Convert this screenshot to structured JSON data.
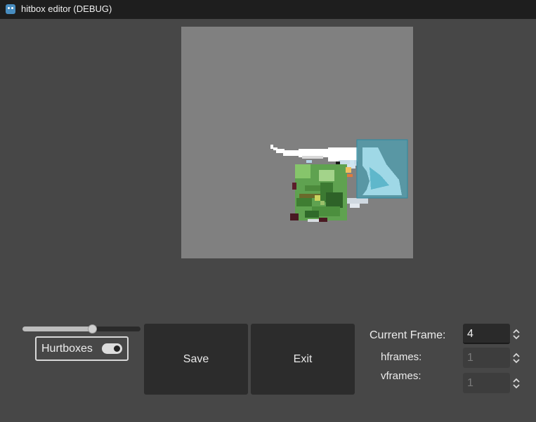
{
  "window": {
    "title": "hitbox editor (DEBUG)",
    "icon": "godot-engine-icon"
  },
  "canvas": {
    "background": "#808080",
    "hurtbox_color": "#3a8fa3"
  },
  "zoom_slider": {
    "value_fraction": 0.59
  },
  "hurtboxes_toggle": {
    "label": "Hurtboxes",
    "checked": true
  },
  "buttons": {
    "save": "Save",
    "exit": "Exit"
  },
  "frame_panel": {
    "current_frame_label": "Current Frame:",
    "current_frame_value": "4",
    "hframes_label": "hframes:",
    "hframes_value": "1",
    "vframes_label": "vframes:",
    "vframes_value": "1"
  }
}
